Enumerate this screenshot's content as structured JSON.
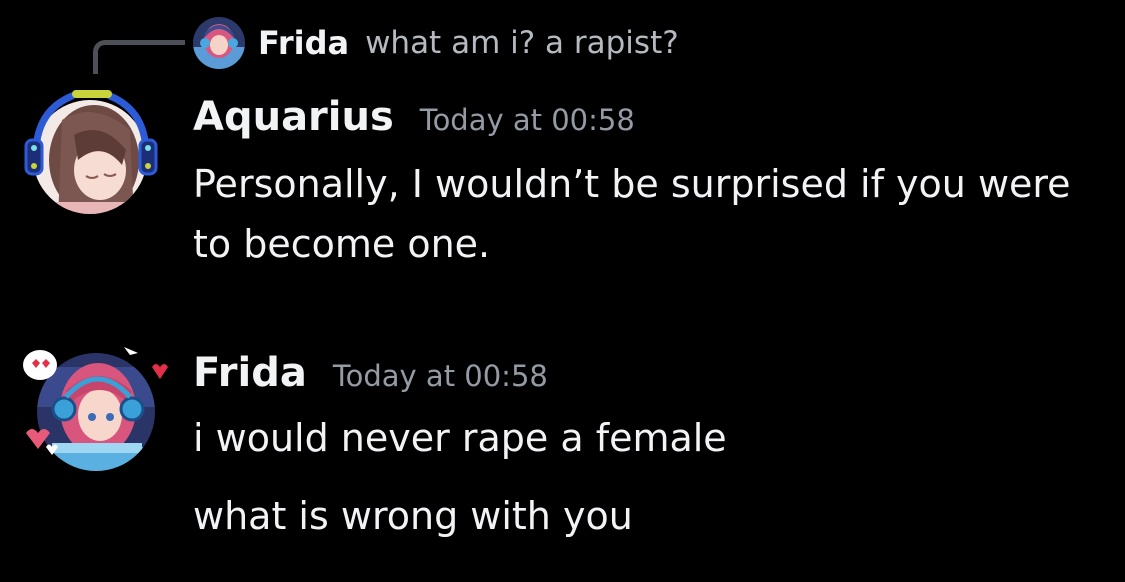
{
  "reply": {
    "author": "Frida",
    "text": "what am i? a rapist?"
  },
  "messages": [
    {
      "author": "Aquarius",
      "timestamp": "Today at 00:58",
      "lines": [
        "Personally, I wouldn’t be surprised if you were to become one."
      ]
    },
    {
      "author": "Frida",
      "timestamp": "Today at 00:58",
      "lines": [
        "i would never rape a female",
        "what is wrong with you"
      ]
    }
  ],
  "colors": {
    "background": "#000000",
    "author": "#f2f3f5",
    "timestamp": "#949ba4",
    "reply_text": "#b5bac1",
    "reply_line": "#4e5058",
    "avatar_decoration": "#2d5bd8"
  },
  "icons": {
    "aquarius_decoration": "headphones-ring-decoration",
    "frida_decoration": "heart-decoration"
  }
}
